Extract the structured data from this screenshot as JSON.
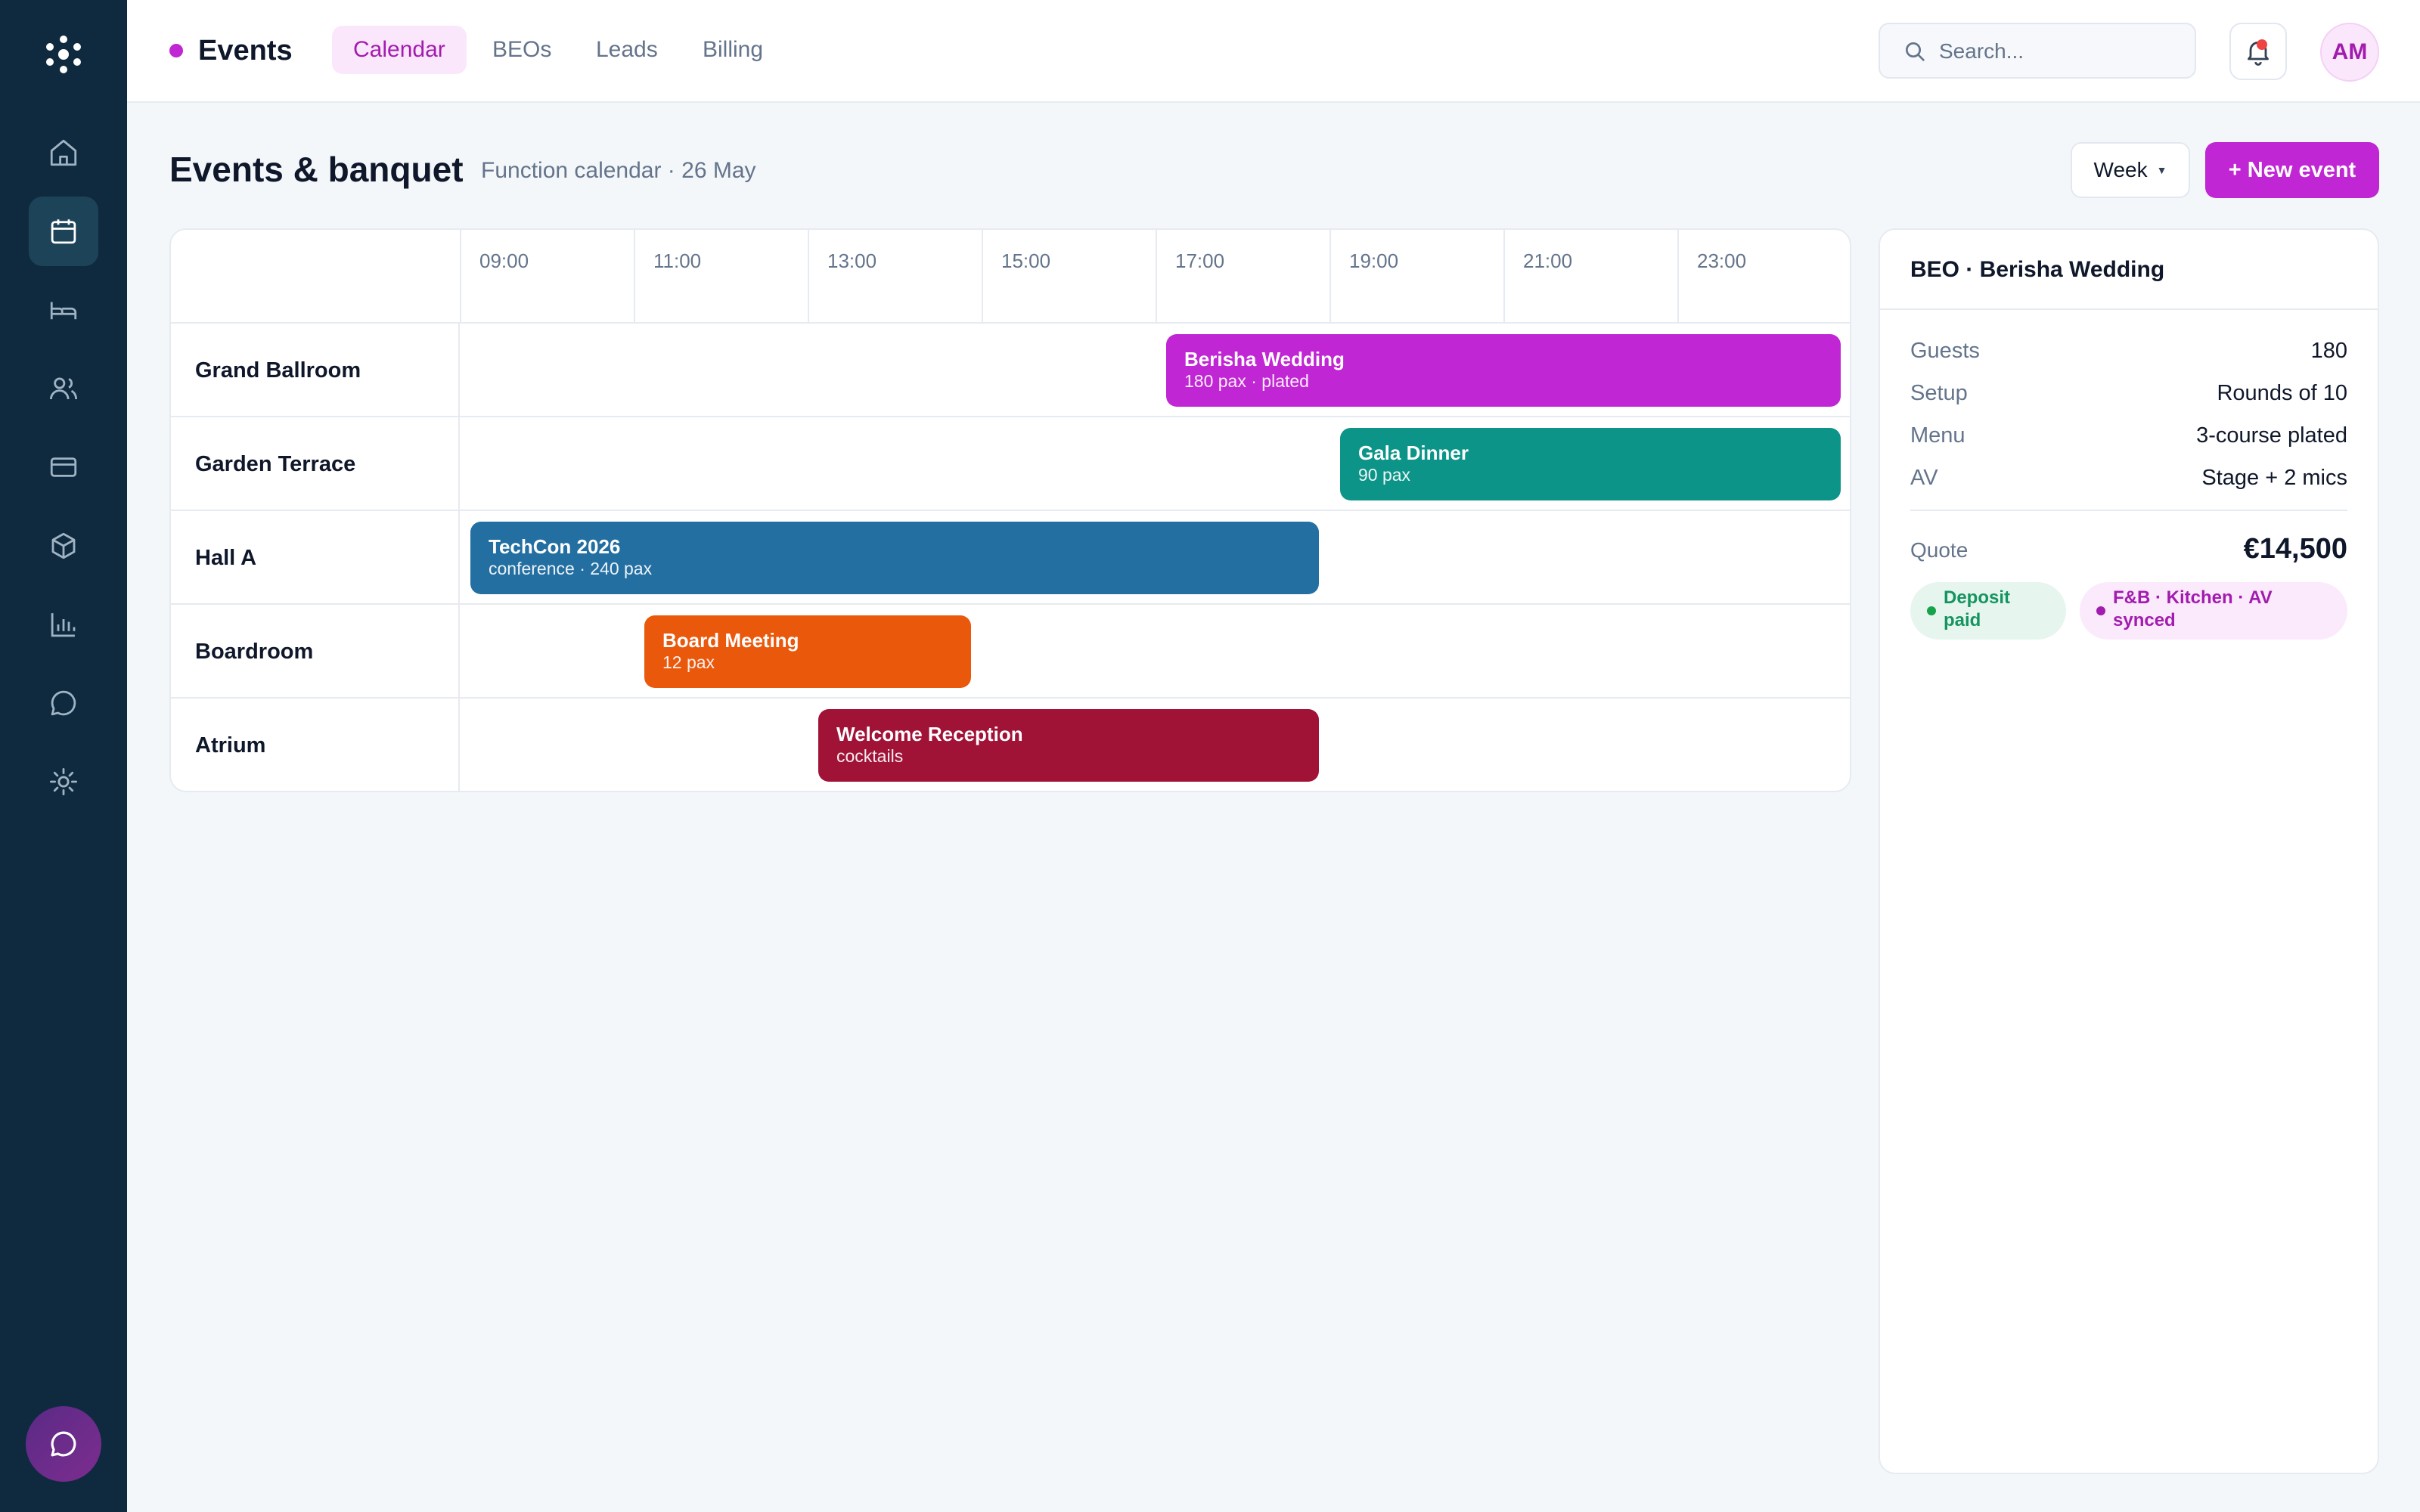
{
  "app": {
    "name": "Events",
    "accent": "#c026d3"
  },
  "tabs": [
    {
      "label": "Calendar",
      "active": true
    },
    {
      "label": "BEOs",
      "active": false
    },
    {
      "label": "Leads",
      "active": false
    },
    {
      "label": "Billing",
      "active": false
    }
  ],
  "search": {
    "placeholder": "Search..."
  },
  "user": {
    "initials": "AM"
  },
  "sidebar": {
    "items": [
      {
        "icon": "home-icon"
      },
      {
        "icon": "calendar-icon",
        "active": true
      },
      {
        "icon": "bed-icon"
      },
      {
        "icon": "users-icon"
      },
      {
        "icon": "credit-card-icon"
      },
      {
        "icon": "box-icon"
      },
      {
        "icon": "bar-chart-icon"
      },
      {
        "icon": "message-icon"
      },
      {
        "icon": "settings-icon"
      }
    ]
  },
  "page": {
    "title": "Events & banquet",
    "subtitle": "Function calendar · 26 May",
    "view_label": "Week",
    "new_event_label": "+ New event"
  },
  "calendar": {
    "times": [
      "09:00",
      "11:00",
      "13:00",
      "15:00",
      "17:00",
      "19:00",
      "21:00",
      "23:00"
    ],
    "rooms": [
      "Grand Ballroom",
      "Garden Terrace",
      "Hall A",
      "Boardroom",
      "Atrium"
    ],
    "events": [
      {
        "room": "Grand Ballroom",
        "title": "Berisha Wedding",
        "sub": "180 pax · plated",
        "start": 17,
        "end": 25,
        "color": "#c026d3"
      },
      {
        "room": "Garden Terrace",
        "title": "Gala Dinner",
        "sub": "90 pax",
        "start": 19,
        "end": 25,
        "color": "#0d9488"
      },
      {
        "room": "Hall A",
        "title": "TechCon 2026",
        "sub": "conference · 240 pax",
        "start": 9,
        "end": 19,
        "color": "#236fa1"
      },
      {
        "room": "Boardroom",
        "title": "Board Meeting",
        "sub": "12 pax",
        "start": 11,
        "end": 15,
        "color": "#ea580c"
      },
      {
        "room": "Atrium",
        "title": "Welcome Reception",
        "sub": "cocktails",
        "start": 13,
        "end": 19,
        "color": "#a11237"
      }
    ]
  },
  "beo": {
    "title": "BEO · Berisha Wedding",
    "rows": [
      {
        "key": "Guests",
        "value": "180"
      },
      {
        "key": "Setup",
        "value": "Rounds of 10"
      },
      {
        "key": "Menu",
        "value": "3-course plated"
      },
      {
        "key": "AV",
        "value": "Stage + 2 mics"
      }
    ],
    "quote_label": "Quote",
    "quote_value": "€14,500",
    "badges": [
      {
        "label": "Deposit paid",
        "tone": "green"
      },
      {
        "label": "F&B · Kitchen · AV synced",
        "tone": "pink"
      }
    ]
  }
}
